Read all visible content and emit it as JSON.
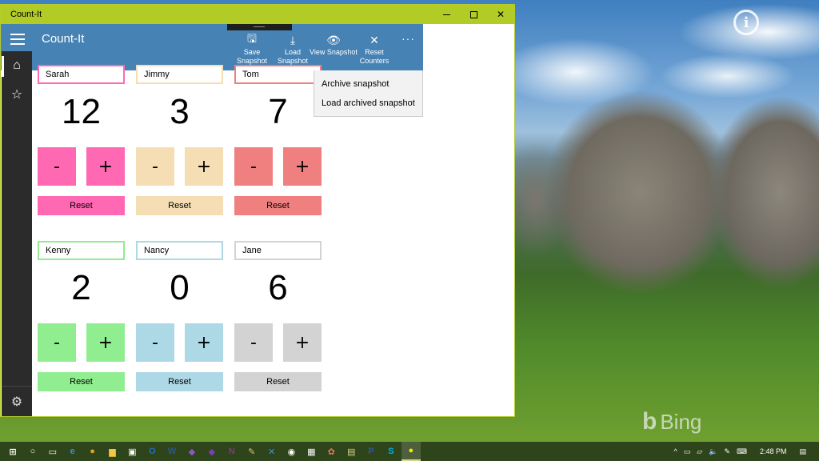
{
  "window": {
    "title": "Count-It",
    "controls": {
      "minimize": "minimize",
      "maximize": "maximize",
      "close": "✕"
    }
  },
  "appbar": {
    "title": "Count-It",
    "commands": [
      {
        "label": "Save Snapshot",
        "icon": "save-icon",
        "glyph": "🖫"
      },
      {
        "label": "Load Snapshot",
        "icon": "download-icon",
        "glyph": "⤓"
      },
      {
        "label": "View Snapshot",
        "icon": "eye-icon",
        "glyph": "👁"
      },
      {
        "label": "Reset Counters",
        "icon": "close-icon",
        "glyph": "✕"
      }
    ],
    "more": "···"
  },
  "overflow_menu": {
    "items": [
      "Archive snapshot",
      "Load archived snapshot"
    ]
  },
  "nav": {
    "items": [
      {
        "name": "home",
        "glyph": "⌂"
      },
      {
        "name": "favorites",
        "glyph": "☆"
      }
    ],
    "settings_glyph": "⚙"
  },
  "counters": [
    {
      "name": "Sarah",
      "count": "12",
      "color": "#ff69b4",
      "minus": "-",
      "plus": "+",
      "reset": "Reset"
    },
    {
      "name": "Jimmy",
      "count": "3",
      "color": "#f5deb3",
      "minus": "-",
      "plus": "+",
      "reset": "Reset"
    },
    {
      "name": "Tom",
      "count": "7",
      "color": "#f08080",
      "minus": "-",
      "plus": "+",
      "reset": "Reset"
    },
    {
      "name": "Kenny",
      "count": "2",
      "color": "#90ee90",
      "minus": "-",
      "plus": "+",
      "reset": "Reset"
    },
    {
      "name": "Nancy",
      "count": "0",
      "color": "#add8e6",
      "minus": "-",
      "plus": "+",
      "reset": "Reset"
    },
    {
      "name": "Jane",
      "count": "6",
      "color": "#d3d3d3",
      "minus": "-",
      "plus": "+",
      "reset": "Reset"
    }
  ],
  "desktop": {
    "bing_label": "Bing",
    "info_glyph": "i"
  },
  "taskbar": {
    "apps": [
      {
        "name": "start",
        "glyph": "⊞",
        "color": "#ffffff"
      },
      {
        "name": "cortana",
        "glyph": "○",
        "color": "#ffffff"
      },
      {
        "name": "task-view",
        "glyph": "▭",
        "color": "#ffffff"
      },
      {
        "name": "edge",
        "glyph": "e",
        "color": "#3b8fe0"
      },
      {
        "name": "chrome",
        "glyph": "●",
        "color": "#e8a317"
      },
      {
        "name": "file-explorer",
        "glyph": "▆",
        "color": "#f2c744"
      },
      {
        "name": "store",
        "glyph": "▣",
        "color": "#ffffff"
      },
      {
        "name": "outlook",
        "glyph": "O",
        "color": "#1e6fc4"
      },
      {
        "name": "word",
        "glyph": "W",
        "color": "#2b5797"
      },
      {
        "name": "visual-studio",
        "glyph": "◆",
        "color": "#8e56c4"
      },
      {
        "name": "visual-studio-2",
        "glyph": "◆",
        "color": "#7a3fb8"
      },
      {
        "name": "onenote",
        "glyph": "N",
        "color": "#80397b"
      },
      {
        "name": "tool",
        "glyph": "✎",
        "color": "#d9c36a"
      },
      {
        "name": "xamarin",
        "glyph": "✕",
        "color": "#3498db"
      },
      {
        "name": "camera",
        "glyph": "◉",
        "color": "#ffffff"
      },
      {
        "name": "calculator",
        "glyph": "▦",
        "color": "#ffffff"
      },
      {
        "name": "paint",
        "glyph": "✿",
        "color": "#e07a5f"
      },
      {
        "name": "notepad",
        "glyph": "▤",
        "color": "#d9d58a"
      },
      {
        "name": "powershell",
        "glyph": "P",
        "color": "#2c5aa0"
      },
      {
        "name": "skype",
        "glyph": "S",
        "color": "#00aff0"
      },
      {
        "name": "tips",
        "glyph": "●",
        "color": "#f2e600"
      }
    ],
    "tray": {
      "chevron": "^",
      "battery": "▭",
      "network": "▱",
      "volume": "🔈",
      "pen": "✎",
      "keyboard": "⌨",
      "time": "2:48 PM",
      "notifications": "▤"
    }
  }
}
